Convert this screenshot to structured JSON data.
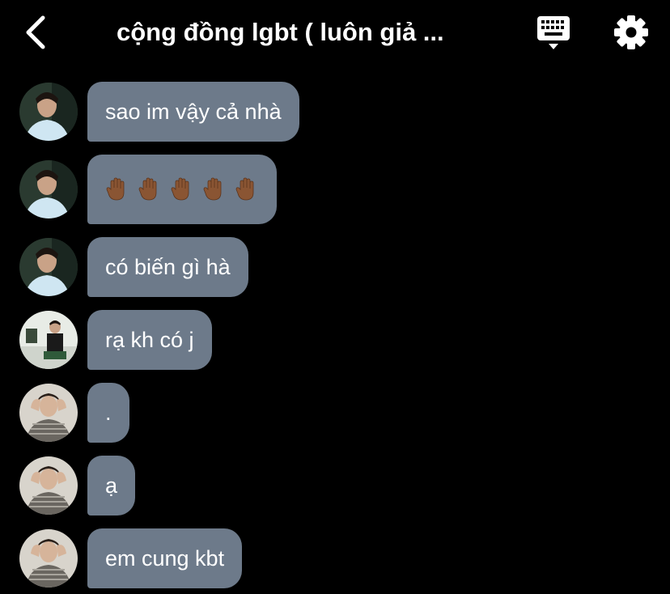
{
  "header": {
    "title": "cộng đồng lgbt ( luôn giả ...",
    "back_icon": "chevron-left-icon",
    "keyboard_icon": "keyboard-icon",
    "settings_icon": "gear-icon"
  },
  "colors": {
    "background": "#000000",
    "bubble": "#6d7a8a",
    "text": "#ffffff"
  },
  "messages": [
    {
      "sender": "user-1",
      "text": "sao im vậy cả nhà"
    },
    {
      "sender": "user-1",
      "text": "",
      "emoji": "raised-hand x5 (dark skin tone)"
    },
    {
      "sender": "user-1",
      "text": "có biến gì hà"
    },
    {
      "sender": "user-2",
      "text": "rạ kh có j"
    },
    {
      "sender": "user-3",
      "text": "."
    },
    {
      "sender": "user-3",
      "text": "ạ"
    },
    {
      "sender": "user-3",
      "text": "em cung kbt"
    }
  ]
}
